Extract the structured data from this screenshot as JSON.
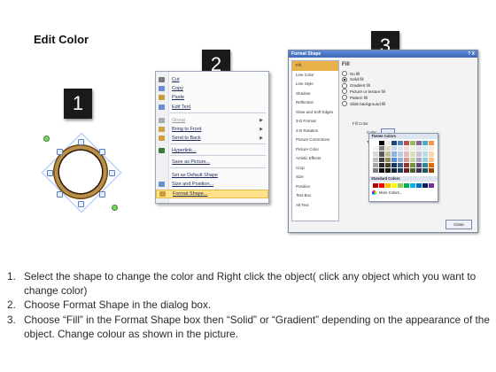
{
  "title": "Edit Color",
  "steps_badges": [
    "1",
    "2",
    "3"
  ],
  "context_menu": {
    "items": [
      {
        "label": "Cut",
        "icon": "scissors-icon",
        "color": "#7a7a7a",
        "enabled": true
      },
      {
        "label": "Copy",
        "icon": "copy-icon",
        "color": "#6a8fd0",
        "enabled": true
      },
      {
        "label": "Paste",
        "icon": "paste-icon",
        "color": "#c99a3a",
        "enabled": true
      },
      {
        "label": "Edit Text",
        "icon": "edit-text-icon",
        "color": "#6a8fd0",
        "enabled": true
      },
      {
        "label": "Group",
        "icon": "group-icon",
        "color": "#aaaaaa",
        "enabled": false,
        "submenu": true
      },
      {
        "label": "Bring to Front",
        "icon": "bring-front-icon",
        "color": "#d0a040",
        "enabled": true,
        "submenu": true
      },
      {
        "label": "Send to Back",
        "icon": "send-back-icon",
        "color": "#d0a040",
        "enabled": true,
        "submenu": true
      },
      {
        "label": "Hyperlink...",
        "icon": "hyperlink-icon",
        "color": "#3a7a3a",
        "enabled": true
      },
      {
        "label": "Save as Picture...",
        "icon": "",
        "color": "",
        "enabled": true
      },
      {
        "label": "Set as Default Shape",
        "icon": "",
        "color": "",
        "enabled": true
      },
      {
        "label": "Size and Position...",
        "icon": "size-position-icon",
        "color": "#6a8fd0",
        "enabled": true
      },
      {
        "label": "Format Shape...",
        "icon": "format-shape-icon",
        "color": "#c99a3a",
        "enabled": true,
        "highlighted": true
      }
    ]
  },
  "dialog": {
    "title": "Format Shape",
    "title_controls": "? X",
    "categories": [
      "Fill",
      "Line Color",
      "Line Style",
      "Shadow",
      "Reflection",
      "Glow and Soft Edges",
      "3-D Format",
      "3-D Rotation",
      "Picture Corrections",
      "Picture Color",
      "Artistic Effects",
      "Crop",
      "Size",
      "Position",
      "Text Box",
      "Alt Text"
    ],
    "selected_category": "Fill",
    "pane_heading": "Fill",
    "fill_options": [
      {
        "label": "No fill",
        "checked": false
      },
      {
        "label": "Solid fill",
        "checked": true
      },
      {
        "label": "Gradient fill",
        "checked": false
      },
      {
        "label": "Picture or texture fill",
        "checked": false
      },
      {
        "label": "Pattern fill",
        "checked": false
      },
      {
        "label": "Slide background fill",
        "checked": false
      }
    ],
    "fill_color_label": "Fill Color",
    "color_label": "Color:",
    "transparency_label": "Transpa",
    "close_label": "Close"
  },
  "palette": {
    "theme_heading": "Theme Colors",
    "standard_heading": "Standard Colors",
    "more_label": "More Colors...",
    "theme_colors": [
      [
        "#ffffff",
        "#000000",
        "#eeece1",
        "#1f497d",
        "#4f81bd",
        "#c0504d",
        "#9bbb59",
        "#8064a2",
        "#4bacc6",
        "#f79646"
      ],
      [
        "#f2f2f2",
        "#7f7f7f",
        "#ddd9c3",
        "#c6d9f0",
        "#dbe5f1",
        "#f2dcdb",
        "#ebf1dd",
        "#e5e0ec",
        "#dbeef3",
        "#fdeada"
      ],
      [
        "#d8d8d8",
        "#595959",
        "#c4bd97",
        "#8db3e2",
        "#b8cce4",
        "#e5b9b7",
        "#d7e3bc",
        "#ccc1d9",
        "#b7dde8",
        "#fbd5b5"
      ],
      [
        "#bfbfbf",
        "#3f3f3f",
        "#938953",
        "#548dd4",
        "#95b3d7",
        "#d99694",
        "#c3d69b",
        "#b2a2c7",
        "#92cddc",
        "#fac08f"
      ],
      [
        "#a5a5a5",
        "#262626",
        "#494429",
        "#17365d",
        "#366092",
        "#953734",
        "#76923c",
        "#5f497a",
        "#31859b",
        "#e36c09"
      ],
      [
        "#7f7f7f",
        "#0c0c0c",
        "#1d1b10",
        "#0f243e",
        "#244061",
        "#632423",
        "#4f6128",
        "#3f3151",
        "#205867",
        "#974806"
      ]
    ],
    "standard_colors": [
      "#c00000",
      "#ff0000",
      "#ffc000",
      "#ffff00",
      "#92d050",
      "#00b050",
      "#00b0f0",
      "#0070c0",
      "#002060",
      "#7030a0"
    ]
  },
  "instructions": [
    {
      "num": "1.",
      "text": "Select the shape to change the color and Right click the object( click any object which you want to change color)"
    },
    {
      "num": "2.",
      "text": "Choose Format Shape in the dialog box."
    },
    {
      "num": "3.",
      "text": "Choose “Fill” in the Format Shape box then “Solid” or “Gradient” depending on the appearance of the object. Change colour as shown in the picture."
    }
  ]
}
